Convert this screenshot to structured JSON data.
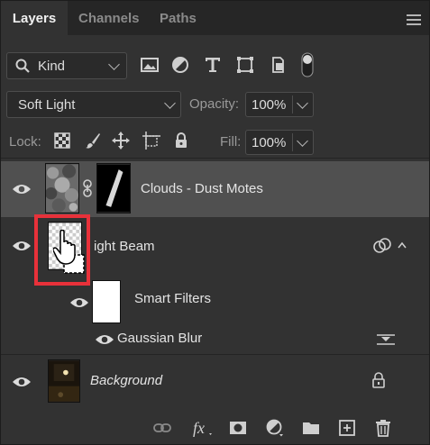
{
  "tabs": [
    {
      "label": "Layers",
      "active": true
    },
    {
      "label": "Channels",
      "active": false
    },
    {
      "label": "Paths",
      "active": false
    }
  ],
  "filter": {
    "kind_label": "Kind",
    "icons": [
      "image-filter-icon",
      "adjustment-filter-icon",
      "type-filter-icon",
      "shape-filter-icon",
      "smart-object-filter-icon",
      "filter-toggle-icon"
    ]
  },
  "blend": {
    "mode": "Soft Light",
    "opacity_label": "Opacity:",
    "opacity_value": "100%"
  },
  "lock": {
    "label": "Lock:",
    "icons": [
      "lock-transparent-pixels-icon",
      "lock-image-pixels-icon",
      "lock-position-icon",
      "lock-artboard-icon",
      "lock-all-icon"
    ],
    "fill_label": "Fill:",
    "fill_value": "100%"
  },
  "layers": [
    {
      "name": "Clouds - Dust Motes",
      "selected": true,
      "has_mask": true
    },
    {
      "name": "ight Beam",
      "smart_object": true,
      "expanded": true
    },
    {
      "name": "Smart Filters",
      "sub": true
    },
    {
      "name": "Gaussian Blur",
      "sub": true
    },
    {
      "name": "Background",
      "italic": true,
      "locked": true
    }
  ],
  "highlight_color": "#e8313a",
  "footer_icons": [
    "link-layers-icon",
    "fx-icon",
    "add-mask-icon",
    "adjustment-layer-icon",
    "group-folder-icon",
    "new-layer-icon",
    "trash-icon"
  ]
}
